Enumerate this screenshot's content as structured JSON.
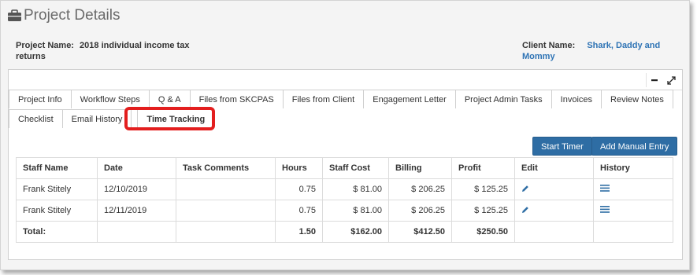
{
  "header": {
    "title": "Project Details"
  },
  "project": {
    "name_label": "Project Name:",
    "name_value": "2018 individual income tax returns"
  },
  "client": {
    "name_label": "Client Name:",
    "name_value": "Shark, Daddy and Mommy"
  },
  "tabs_row1": [
    "Project Info",
    "Workflow Steps",
    "Q & A",
    "Files from SKCPAS",
    "Files from Client",
    "Engagement Letter",
    "Project Admin Tasks",
    "Invoices",
    "Review Notes"
  ],
  "tabs_row2": [
    "Checklist",
    "Email History",
    "Time Tracking"
  ],
  "active_tab": "Time Tracking",
  "actions": {
    "start_timer": "Start Timer",
    "add_manual_entry": "Add Manual Entry"
  },
  "table": {
    "headers": [
      "Staff Name",
      "Date",
      "Task Comments",
      "Hours",
      "Staff Cost",
      "Billing",
      "Profit",
      "Edit",
      "History"
    ],
    "rows": [
      {
        "staff": "Frank Stitely",
        "date": "12/10/2019",
        "comments": "",
        "hours": "0.75",
        "cost": "$ 81.00",
        "billing": "$ 206.25",
        "profit": "$ 125.25"
      },
      {
        "staff": "Frank Stitely",
        "date": "12/11/2019",
        "comments": "",
        "hours": "0.75",
        "cost": "$ 81.00",
        "billing": "$ 206.25",
        "profit": "$ 125.25"
      }
    ],
    "total": {
      "label": "Total:",
      "hours": "1.50",
      "cost": "$162.00",
      "billing": "$412.50",
      "profit": "$250.50"
    }
  },
  "icons": {
    "title": "briefcase-icon",
    "minimize": "minimize-icon",
    "expand": "expand-icon",
    "edit": "pencil-icon",
    "history": "list-icon"
  },
  "colors": {
    "primary_button": "#2e6da4",
    "link": "#2f74b5",
    "highlight": "#e31e1e",
    "icon": "#2e6da4"
  }
}
